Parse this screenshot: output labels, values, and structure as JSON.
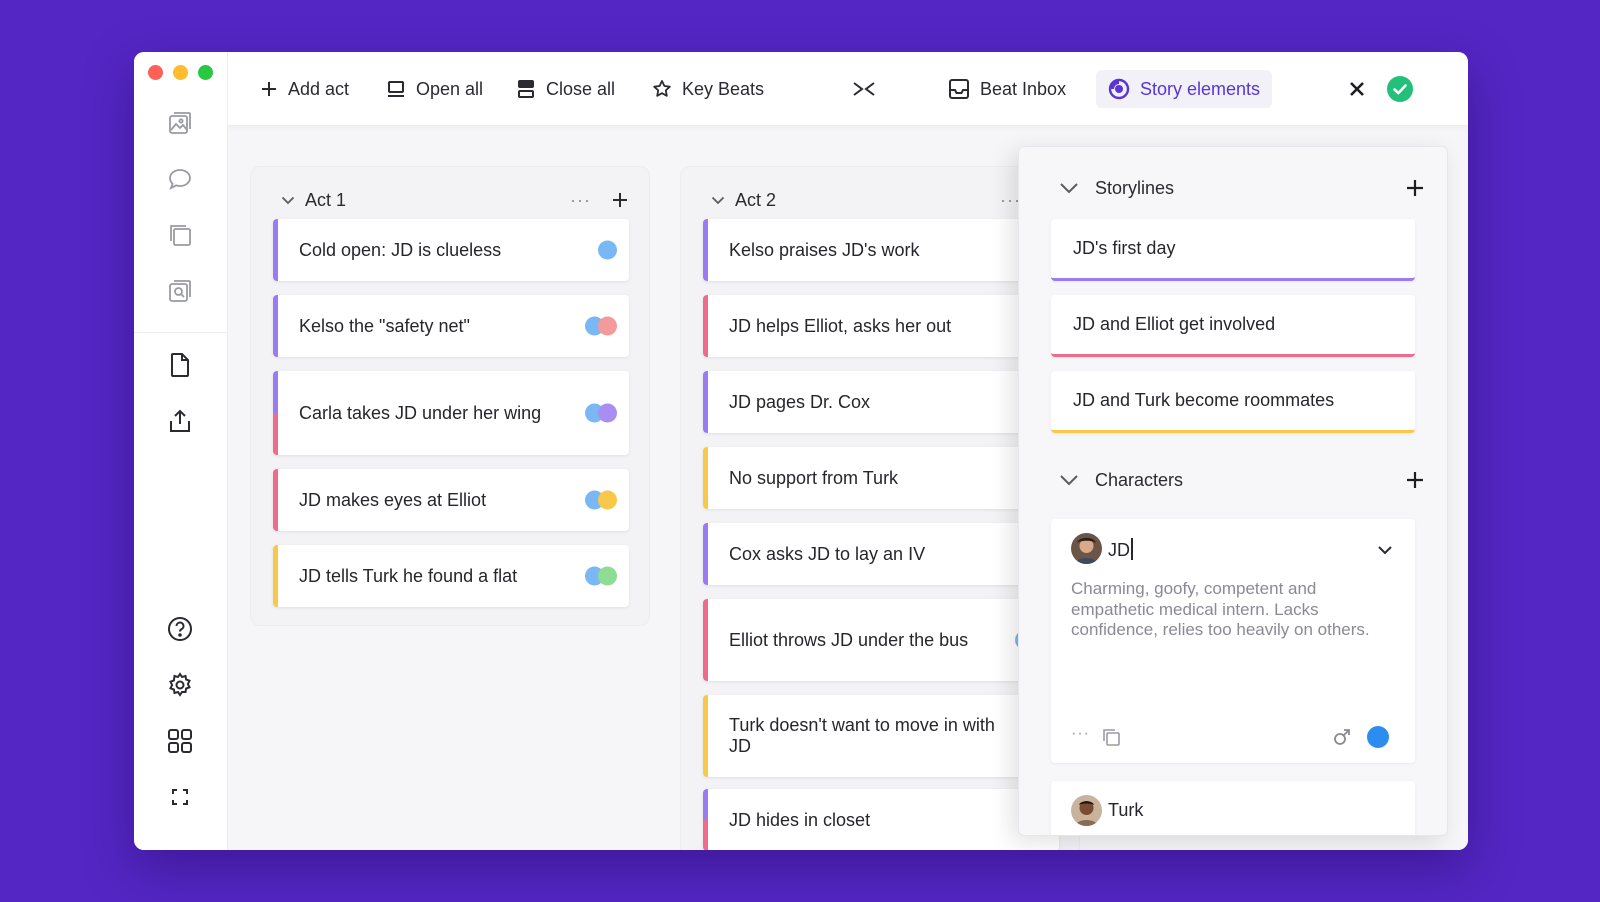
{
  "colors": {
    "purple": "#9a7cf2",
    "pink": "#ef6b8c",
    "yellow": "#f7c84a",
    "blue": "#7ab8f5",
    "salmon": "#f59a9a",
    "violet": "#a98df0",
    "green": "#8fdc94",
    "accent": "#5a34d6",
    "check": "#23c07a"
  },
  "toolbar": {
    "add_act": "Add act",
    "open_all": "Open all",
    "close_all": "Close all",
    "key_beats": "Key Beats",
    "beat_inbox": "Beat Inbox",
    "story_elements": "Story elements"
  },
  "sidebar": {
    "icons": [
      "image-icon",
      "chat-bubble-icon",
      "copy-icon",
      "search-image-icon",
      "document-icon",
      "share-icon",
      "help-icon",
      "gear-icon",
      "grid-icon",
      "fullscreen-icon"
    ]
  },
  "acts": [
    {
      "title": "Act 1",
      "beats": [
        {
          "text": "Cold open: JD is clueless",
          "bar": [
            "purple"
          ],
          "dots": [
            "blue"
          ]
        },
        {
          "text": "Kelso the \"safety net\"",
          "bar": [
            "purple"
          ],
          "dots": [
            "blue",
            "salmon"
          ]
        },
        {
          "text": "Carla takes JD under her wing",
          "bar": [
            "purple",
            "pink"
          ],
          "dots": [
            "blue",
            "violet"
          ]
        },
        {
          "text": "JD makes eyes at Elliot",
          "bar": [
            "pink"
          ],
          "dots": [
            "blue",
            "yellow"
          ]
        },
        {
          "text": "JD tells Turk he found a flat",
          "bar": [
            "yellow"
          ],
          "dots": [
            "blue",
            "green"
          ]
        }
      ]
    },
    {
      "title": "Act 2",
      "beats": [
        {
          "text": "Kelso praises JD's work",
          "bar": [
            "purple"
          ],
          "dots": []
        },
        {
          "text": "JD helps Elliot, asks her out",
          "bar": [
            "pink"
          ],
          "dots": []
        },
        {
          "text": "JD pages Dr. Cox",
          "bar": [
            "purple"
          ],
          "dots": []
        },
        {
          "text": "No support from Turk",
          "bar": [
            "yellow"
          ],
          "dots": []
        },
        {
          "text": "Cox asks JD to lay an IV",
          "bar": [
            "purple"
          ],
          "dots": []
        },
        {
          "text": "Elliot throws JD under the bus",
          "bar": [
            "pink"
          ],
          "dots": [
            "blue",
            "yellow"
          ]
        },
        {
          "text": "Turk doesn't want to move in with JD",
          "bar": [
            "yellow"
          ],
          "dots": []
        },
        {
          "text": "JD hides in closet",
          "bar": [
            "purple",
            "pink"
          ],
          "dots": []
        }
      ]
    }
  ],
  "panel": {
    "storylines_title": "Storylines",
    "storylines": [
      {
        "text": "JD's first day",
        "color": "purple"
      },
      {
        "text": "JD and Elliot get involved",
        "color": "pink"
      },
      {
        "text": "JD and Turk become roommates",
        "color": "yellow"
      }
    ],
    "characters_title": "Characters",
    "characters": [
      {
        "name": "JD",
        "description": "Charming, goofy, competent and empathetic medical intern. Lacks confidence, relies too heavily on others."
      },
      {
        "name": "Turk"
      }
    ]
  }
}
